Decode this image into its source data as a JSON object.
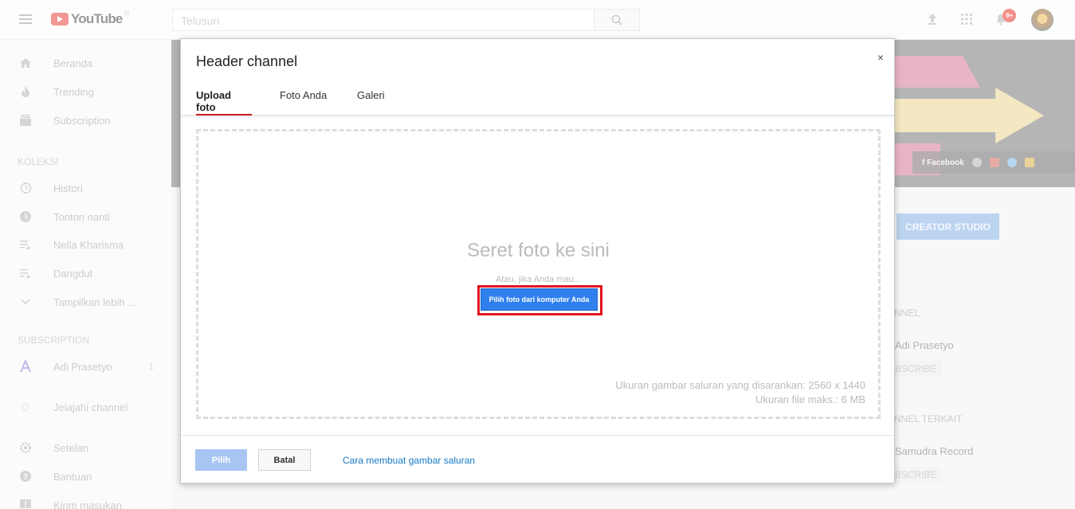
{
  "topbar": {
    "logo_text": "YouTube",
    "logo_sup": "ID",
    "search_placeholder": "Telusuri",
    "notification_count": "9+"
  },
  "sidebar": {
    "items_main": [
      {
        "label": "Beranda",
        "icon": "home-icon"
      },
      {
        "label": "Trending",
        "icon": "flame-icon"
      },
      {
        "label": "Subscription",
        "icon": "subscriptions-icon"
      }
    ],
    "koleksi_heading": "KOLEKSI",
    "items_koleksi": [
      {
        "label": "Histori",
        "icon": "history-icon"
      },
      {
        "label": "Tonton nanti",
        "icon": "clock-icon"
      },
      {
        "label": "Nella Kharisma",
        "icon": "playlist-icon"
      },
      {
        "label": "Dangdut",
        "icon": "playlist-icon"
      },
      {
        "label": "Tampilkan lebih ...",
        "icon": "chevron-down-icon"
      }
    ],
    "subscription_heading": "SUBSCRIPTION",
    "subscription_item": {
      "label": "Adi Prasetyo",
      "count": "1"
    },
    "browse_channels": "Jelajahi channel",
    "items_bottom": [
      {
        "label": "Setelan",
        "icon": "gear-icon"
      },
      {
        "label": "Bantuan",
        "icon": "help-icon"
      },
      {
        "label": "Kirim masukan",
        "icon": "feedback-icon"
      }
    ]
  },
  "banner": {
    "social_facebook": "Facebook"
  },
  "right_column": {
    "creator_studio": "CREATOR STUDIO",
    "channel_heading": "NNEL",
    "channel_name": "Adi Prasetyo",
    "subscribe_1": "BSCRIBE",
    "related_heading": "NNEL TERKAIT",
    "related_name": "Samudra Record",
    "subscribe_2": "BSCRIBE"
  },
  "modal": {
    "title": "Header channel",
    "close_label": "×",
    "tabs": [
      {
        "label": "Upload foto",
        "active": true
      },
      {
        "label": "Foto Anda",
        "active": false
      },
      {
        "label": "Galeri",
        "active": false
      }
    ],
    "drop_title": "Seret foto ke sini",
    "drop_subtitle": "Atau, jika Anda mau...",
    "choose_button": "Pilih foto dari komputer Anda",
    "recommended_size": "Ukuran gambar saluran yang disarankan: 2560 x 1440",
    "max_file_size": "Ukuran file maks.: 6 MB",
    "select_button": "Pilih",
    "cancel_button": "Batal",
    "help_link": "Cara membuat gambar saluran"
  },
  "colors": {
    "highlight_border": "#e0111f",
    "primary_blue": "#2f80ed",
    "link_blue": "#167ac6",
    "active_tab": "#cc181e"
  }
}
